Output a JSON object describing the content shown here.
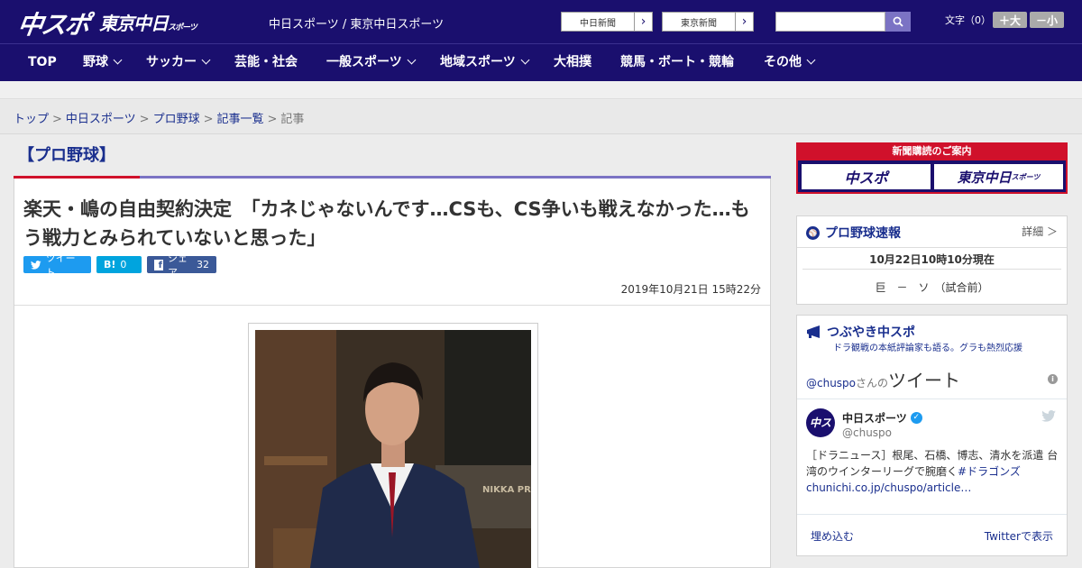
{
  "header": {
    "logo_main": "中スポ",
    "logo_tokyo": "東京中日",
    "logo_tokyo_sub": "スポーツ",
    "site_links": "中日スポーツ / 東京中日スポーツ",
    "paper_buttons": [
      "中日新聞",
      "東京新聞"
    ],
    "search_placeholder": "",
    "font_label": "文字（0）",
    "font_plus": "＋大",
    "font_minus": "－小"
  },
  "nav": {
    "items": [
      {
        "label": "TOP",
        "dropdown": false
      },
      {
        "label": "野球",
        "dropdown": true
      },
      {
        "label": "サッカー",
        "dropdown": true
      },
      {
        "label": "芸能・社会",
        "dropdown": false
      },
      {
        "label": "一般スポーツ",
        "dropdown": true
      },
      {
        "label": "地域スポーツ",
        "dropdown": true
      },
      {
        "label": "大相撲",
        "dropdown": false
      },
      {
        "label": "競馬・ボート・競輪",
        "dropdown": false
      },
      {
        "label": "その他",
        "dropdown": true
      }
    ]
  },
  "breadcrumb": {
    "items": [
      "トップ",
      "中日スポーツ",
      "プロ野球",
      "記事一覧"
    ],
    "current": "記事"
  },
  "article": {
    "category": "【プロ野球】",
    "headline": "楽天・嶋の自由契約決定　「カネじゃないんです…CSも、CS争いも戦えなかった…もう戦力とみられていないと思った」",
    "share": {
      "tweet_label": "ツイート",
      "hatena_label": "B!",
      "hatena_count": "0",
      "facebook_label": "シェア",
      "facebook_count": "32"
    },
    "date": "2019年10月21日 15時22分",
    "photo_sign_text": "NIKKA PRESTIGE"
  },
  "sidebar": {
    "subscription": {
      "title": "新聞購読のご案内",
      "logo1": "中スポ",
      "logo2": "東京中日",
      "logo2_sub": "スポーツ"
    },
    "scores": {
      "title": "プロ野球速報",
      "detail_link": "詳細 ＞",
      "timestamp": "10月22日10時10分現在",
      "game": "巨　－　ソ　（試合前）"
    },
    "tweets": {
      "title": "つぶやき中スポ",
      "subtitle": "ドラ観戦の本紙評論家も語る。グラも熱烈応援",
      "handle_prefix": "@chuspo",
      "handle_mid": "さんの",
      "handle_suffix": "ツイート",
      "account_name": "中日スポーツ",
      "account_handle": "@chuspo",
      "tweet_text": "［ドラニュース］根尾、石橋、博志、清水を派遣 台湾のウインターリーグで腕磨く",
      "tweet_tag": "#ドラゴンズ",
      "tweet_link": "chunichi.co.jp/chuspo/article…",
      "embed_label": "埋め込む",
      "view_on_twitter": "Twitterで表示"
    }
  },
  "colors": {
    "header_bg": "#1a0f6e",
    "accent_red": "#d0112b",
    "accent_purple": "#7b73c4",
    "link_blue": "#1a2f8e",
    "twitter_blue": "#1d9bf0",
    "facebook_blue": "#3b5998"
  }
}
